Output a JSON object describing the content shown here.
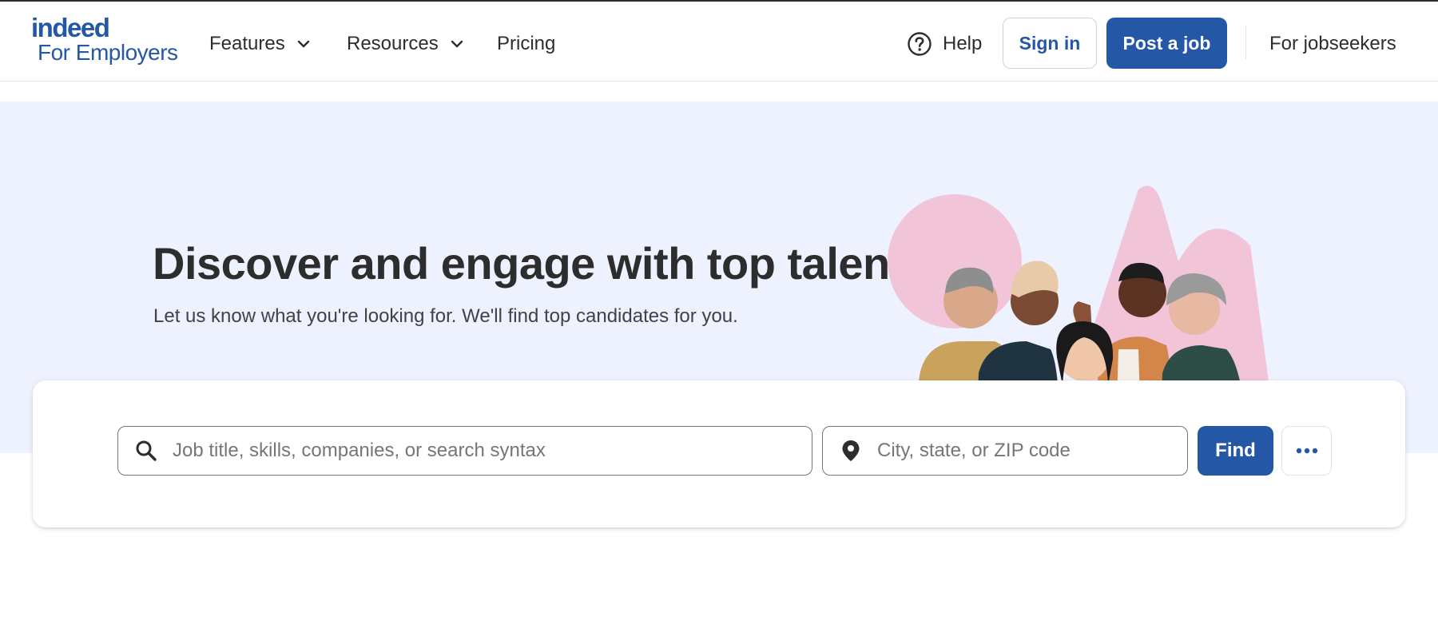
{
  "brand": {
    "logo_word": "indeed",
    "logo_sub": "For Employers",
    "accent": "#2557a7"
  },
  "nav": {
    "features": "Features",
    "resources": "Resources",
    "pricing": "Pricing",
    "help": "Help",
    "sign_in": "Sign in",
    "post_job": "Post a job",
    "for_jobseekers": "For jobseekers"
  },
  "hero": {
    "title": "Discover and engage with top talent",
    "subtitle": "Let us know what you're looking for. We'll find top candidates for you.",
    "background": "#eef1fe"
  },
  "search": {
    "what_placeholder": "Job title, skills, companies, or search syntax",
    "where_placeholder": "City, state, or ZIP code",
    "find_label": "Find"
  }
}
